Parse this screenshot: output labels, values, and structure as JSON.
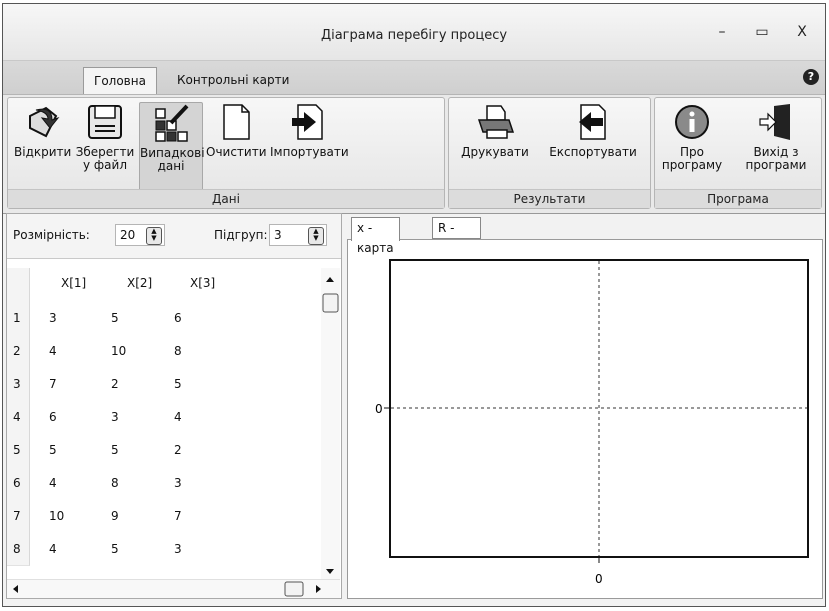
{
  "window": {
    "title": "Діаграма перебігу процесу",
    "controls": {
      "minimize": "–",
      "maximize": "▭",
      "close": "X"
    }
  },
  "tabs": [
    {
      "label": "Головна",
      "active": true
    },
    {
      "label": "Контрольні карти",
      "active": false
    }
  ],
  "ribbon": {
    "groups": {
      "data": "Дані",
      "results": "Результати",
      "program": "Програма"
    },
    "buttons": {
      "open": {
        "line1": "Відкрити",
        "line2": "",
        "icon": "open-icon"
      },
      "save": {
        "line1": "Зберегти",
        "line2": "у файл",
        "icon": "floppy-icon"
      },
      "random": {
        "line1": "Випадкові",
        "line2": "дані",
        "icon": "random-data-icon"
      },
      "clear": {
        "line1": "Очистити",
        "line2": "",
        "icon": "blank-page-icon"
      },
      "import": {
        "line1": "Імпортувати",
        "line2": "",
        "icon": "import-icon"
      },
      "print": {
        "line1": "Друкувати",
        "line2": "",
        "icon": "printer-icon"
      },
      "export": {
        "line1": "Експортувати",
        "line2": "",
        "icon": "export-icon"
      },
      "about": {
        "line1": "Про",
        "line2": "програму",
        "icon": "info-icon"
      },
      "exit": {
        "line1": "Вихід з",
        "line2": "програми",
        "icon": "exit-door-icon"
      }
    }
  },
  "params": {
    "size_label": "Розмірність:",
    "size_value": "20",
    "groups_label": "Підгруп:",
    "groups_value": "3"
  },
  "table": {
    "headers": [
      "X[1]",
      "X[2]",
      "X[3]"
    ],
    "rows": [
      {
        "n": "1",
        "v": [
          "3",
          "5",
          "6"
        ]
      },
      {
        "n": "2",
        "v": [
          "4",
          "10",
          "8"
        ]
      },
      {
        "n": "3",
        "v": [
          "7",
          "2",
          "5"
        ]
      },
      {
        "n": "4",
        "v": [
          "6",
          "3",
          "4"
        ]
      },
      {
        "n": "5",
        "v": [
          "5",
          "5",
          "2"
        ]
      },
      {
        "n": "6",
        "v": [
          "4",
          "8",
          "3"
        ]
      },
      {
        "n": "7",
        "v": [
          "10",
          "9",
          "7"
        ]
      },
      {
        "n": "8",
        "v": [
          "4",
          "5",
          "3"
        ]
      }
    ]
  },
  "chart_tabs": [
    {
      "label": "x - карта",
      "active": true
    },
    {
      "label": "R - карта",
      "active": false
    }
  ],
  "chart_data": {
    "type": "line",
    "series": [],
    "x_tick_labels": [
      "0"
    ],
    "y_tick_labels": [
      "0"
    ],
    "grid": "dashed center crosshair"
  }
}
